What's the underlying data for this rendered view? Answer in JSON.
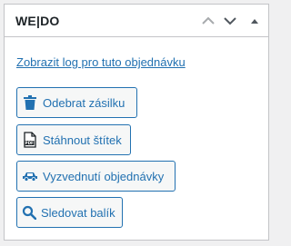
{
  "metabox": {
    "title": "WE|DO",
    "controls": {
      "move_up_icon": "chevron-up-icon",
      "move_down_icon": "chevron-down-icon",
      "toggle_icon": "triangle-up-icon"
    }
  },
  "content": {
    "log_link": "Zobrazit log pro tuto objednávku",
    "buttons": {
      "remove_shipment": "Odebrat zásilku",
      "download_label": "Stáhnout štítek",
      "pickup_order": "Vyzvednutí objednávky",
      "track_package": "Sledovat balík"
    },
    "icons": {
      "remove_shipment": "trash-icon",
      "download_label": "pdf-file-icon",
      "pickup_order": "car-icon",
      "track_package": "search-icon"
    }
  },
  "colors": {
    "accent": "#2271b1",
    "icon_dark": "#1d2327",
    "border": "#c3c4c7",
    "control_grey": "#8c8f94"
  }
}
